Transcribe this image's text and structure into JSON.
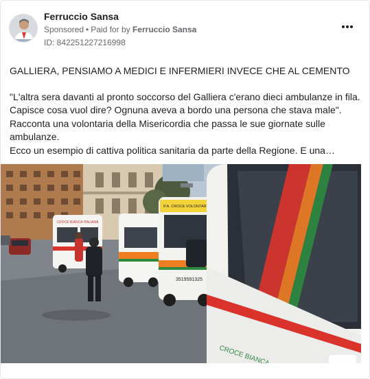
{
  "post": {
    "author": "Ferruccio Sansa",
    "sponsored_label": "Sponsored",
    "separator": "•",
    "paid_for_prefix": "Paid for by",
    "paid_for_name": "Ferruccio Sansa",
    "ad_id": "ID: 842251227216998",
    "headline": "GALLIERA, PENSIAMO A MEDICI E INFERMIERI INVECE CHE AL CEMENTO",
    "paragraph_lines": [
      "\"L'altra sera davanti al pronto soccorso del Galliera c'erano dieci ambulanze in fila.",
      "Capisce cosa vuol dire? Ognuna aveva a bordo una persona che stava male\".",
      "Racconta una volontaria della Misericordia che passa le sue giornate sulle",
      "ambulanze.",
      "Ecco un esempio di cattiva politica sanitaria da parte della Regione. E una…"
    ]
  },
  "image": {
    "ambulance_text_left": "CROCE BIANCA ITALIANA",
    "ambulance_text_center": "P.A. CROCE VOLONTARIE",
    "ambulance_phone": "3519591325",
    "ambulance_side_text": "CROCE BIANCA"
  },
  "colors": {
    "text_primary": "#1c1e21",
    "text_secondary": "#65676b",
    "border": "#e4e6eb",
    "ambulance_red": "#d9332b",
    "ambulance_orange": "#ef7d22",
    "ambulance_green": "#2c8a3e"
  },
  "icons": {
    "more_options": "ellipsis-icon"
  }
}
